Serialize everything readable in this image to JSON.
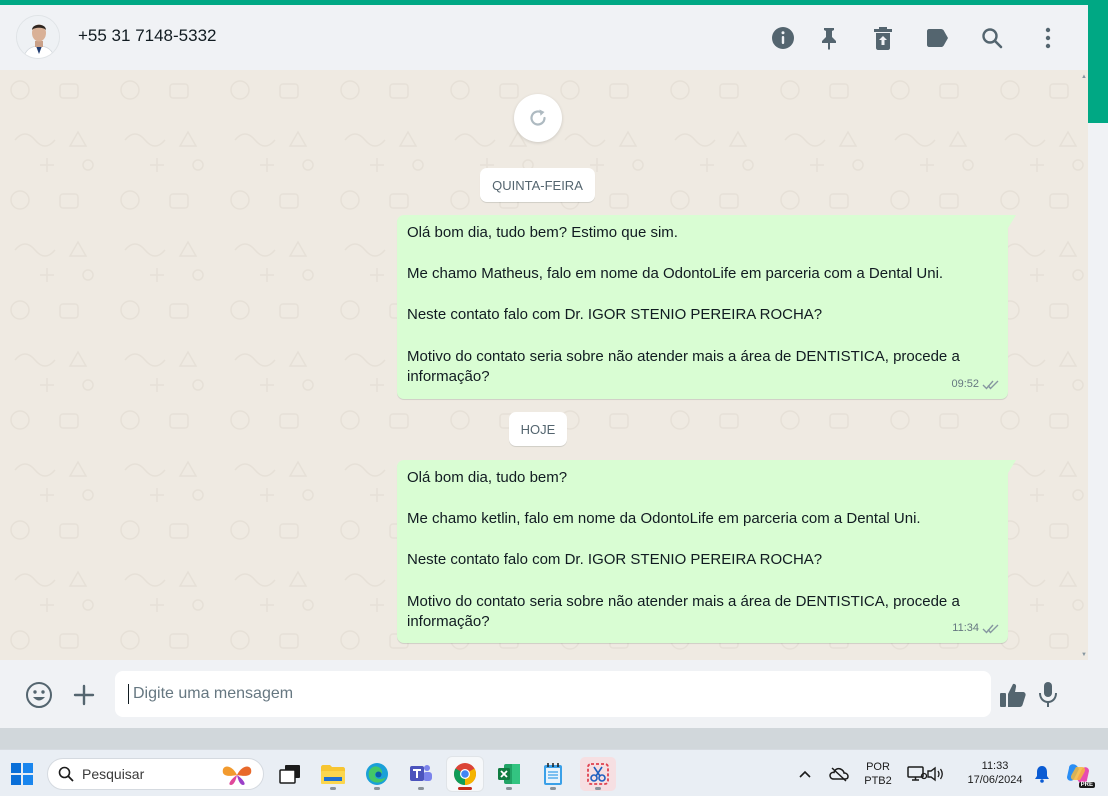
{
  "contact": {
    "name": "+55 31 7148-5332"
  },
  "dates": {
    "first": "QUINTA-FEIRA",
    "second": "HOJE"
  },
  "messages": [
    {
      "paragraphs": [
        "Olá bom dia, tudo bem? Estimo que sim.",
        "Me chamo Matheus, falo em nome da OdontoLife em parceria com a Dental Uni.",
        "Neste contato falo com Dr. IGOR STENIO PEREIRA ROCHA?",
        "Motivo do contato seria sobre não atender mais a área de DENTISTICA, procede a informação?"
      ],
      "time": "09:52"
    },
    {
      "paragraphs": [
        "Olá bom dia, tudo bem?",
        "Me chamo ketlin, falo em nome da OdontoLife em parceria com a Dental Uni.",
        "Neste contato falo com Dr. IGOR STENIO PEREIRA ROCHA?",
        "Motivo do contato seria sobre não atender mais a área de DENTISTICA, procede a informação?"
      ],
      "time": "11:34"
    }
  ],
  "composer": {
    "placeholder": "Digite uma mensagem"
  },
  "taskbar": {
    "search_label": "Pesquisar",
    "language": "POR",
    "layout": "PTB2",
    "time": "11:33",
    "date": "17/06/2024",
    "copilot_badge": "PRE"
  },
  "colors": {
    "accent": "#00a884",
    "outgoing_bubble": "#d9fdd3",
    "chat_bg": "#efeae2",
    "panel_bg": "#f0f2f5"
  }
}
